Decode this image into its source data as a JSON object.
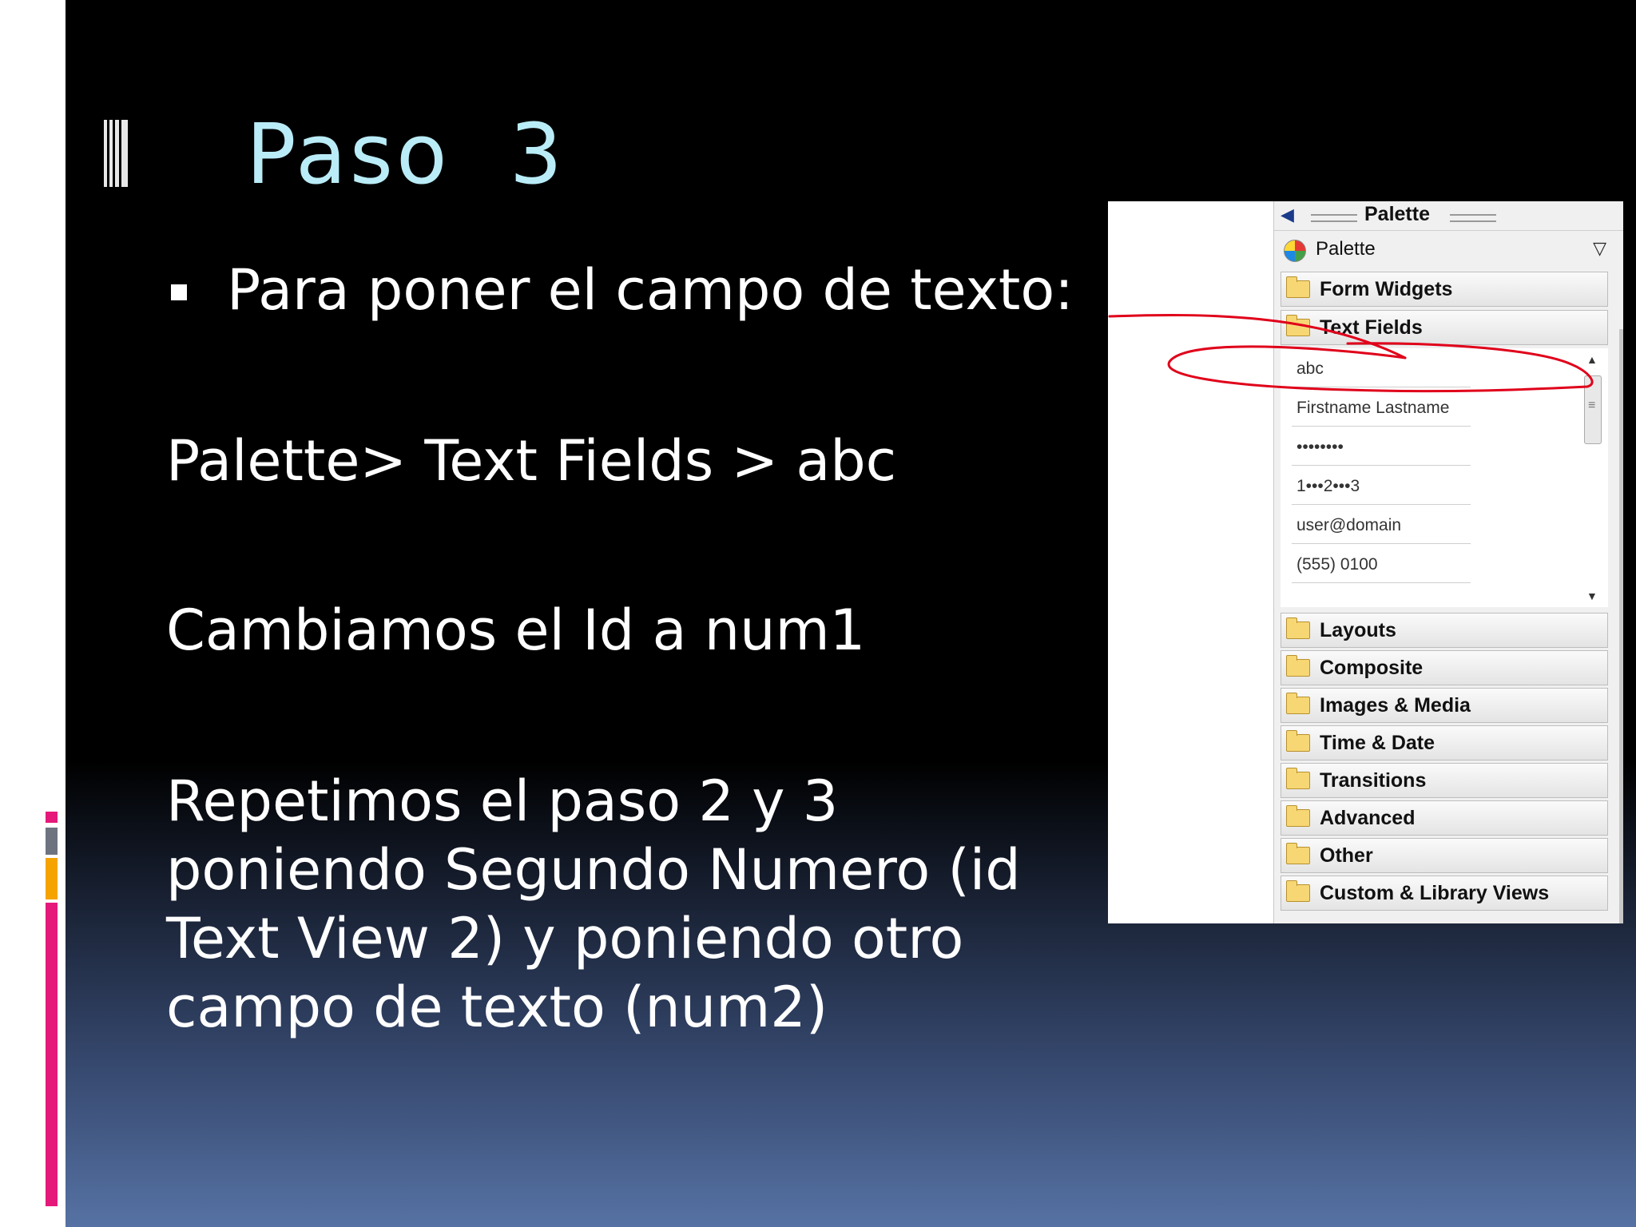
{
  "slide": {
    "title": "Paso  3",
    "bullet_text": "Para poner el campo de texto:",
    "path_text": "Palette> Text Fields > abc",
    "rename_text": "Cambiamos el Id a num1",
    "repeat_text": "Repetimos el paso 2 y 3 poniendo Segundo Numero (id Text View 2) y poniendo otro campo de texto (num2)"
  },
  "palette": {
    "header": "Palette",
    "selector": "Palette",
    "categories_top": [
      "Form Widgets",
      "Text Fields"
    ],
    "text_fields": [
      "abc",
      "Firstname Lastname",
      "••••••••",
      "1•••2•••3",
      "user@domain",
      "(555) 0100"
    ],
    "categories_bottom": [
      "Layouts",
      "Composite",
      "Images & Media",
      "Time & Date",
      "Transitions",
      "Advanced",
      "Other",
      "Custom & Library Views"
    ]
  },
  "colors": {
    "title": "#b9ecf7",
    "annotation": "#e0001a",
    "accent_magenta": "#e5197a",
    "accent_orange": "#f5a300",
    "accent_gray": "#6d7480"
  }
}
